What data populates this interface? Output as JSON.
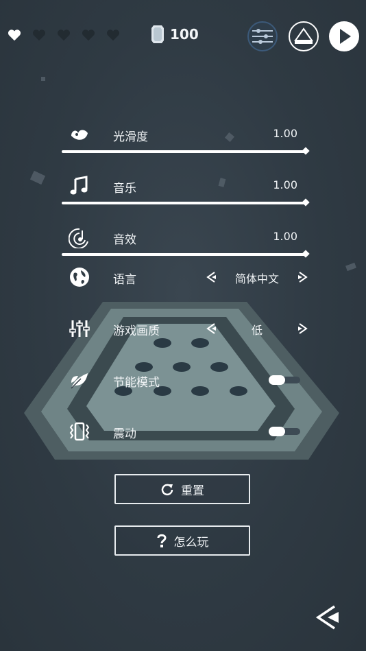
{
  "header": {
    "lives_total": 5,
    "lives_filled": 1,
    "gems": "100"
  },
  "settings": {
    "smoothness": {
      "label": "光滑度",
      "value": "1.00",
      "level": 1.0
    },
    "music": {
      "label": "音乐",
      "value": "1.00",
      "level": 1.0
    },
    "sound": {
      "label": "音效",
      "value": "1.00",
      "level": 1.0
    },
    "language": {
      "label": "语言",
      "value": "简体中文"
    },
    "quality": {
      "label": "游戏画质",
      "value": "低"
    },
    "power_saving": {
      "label": "节能模式",
      "on": false
    },
    "vibration": {
      "label": "震动",
      "on": false
    }
  },
  "buttons": {
    "reset": "重置",
    "how_to_play": "怎么玩"
  },
  "icons": [
    "heart-icon",
    "gem-icon",
    "levels-icon",
    "theme-icon",
    "play-icon",
    "wave-icon",
    "music-note-icon",
    "sound-icon",
    "globe-icon",
    "sliders-icon",
    "leaf-icon",
    "vibrate-icon",
    "arrow-left-icon",
    "arrow-right-icon",
    "reset-icon",
    "question-icon",
    "back-icon"
  ],
  "colors": {
    "background": "#2f3a43",
    "foreground": "#ffffff",
    "board": "#6a7e80"
  }
}
